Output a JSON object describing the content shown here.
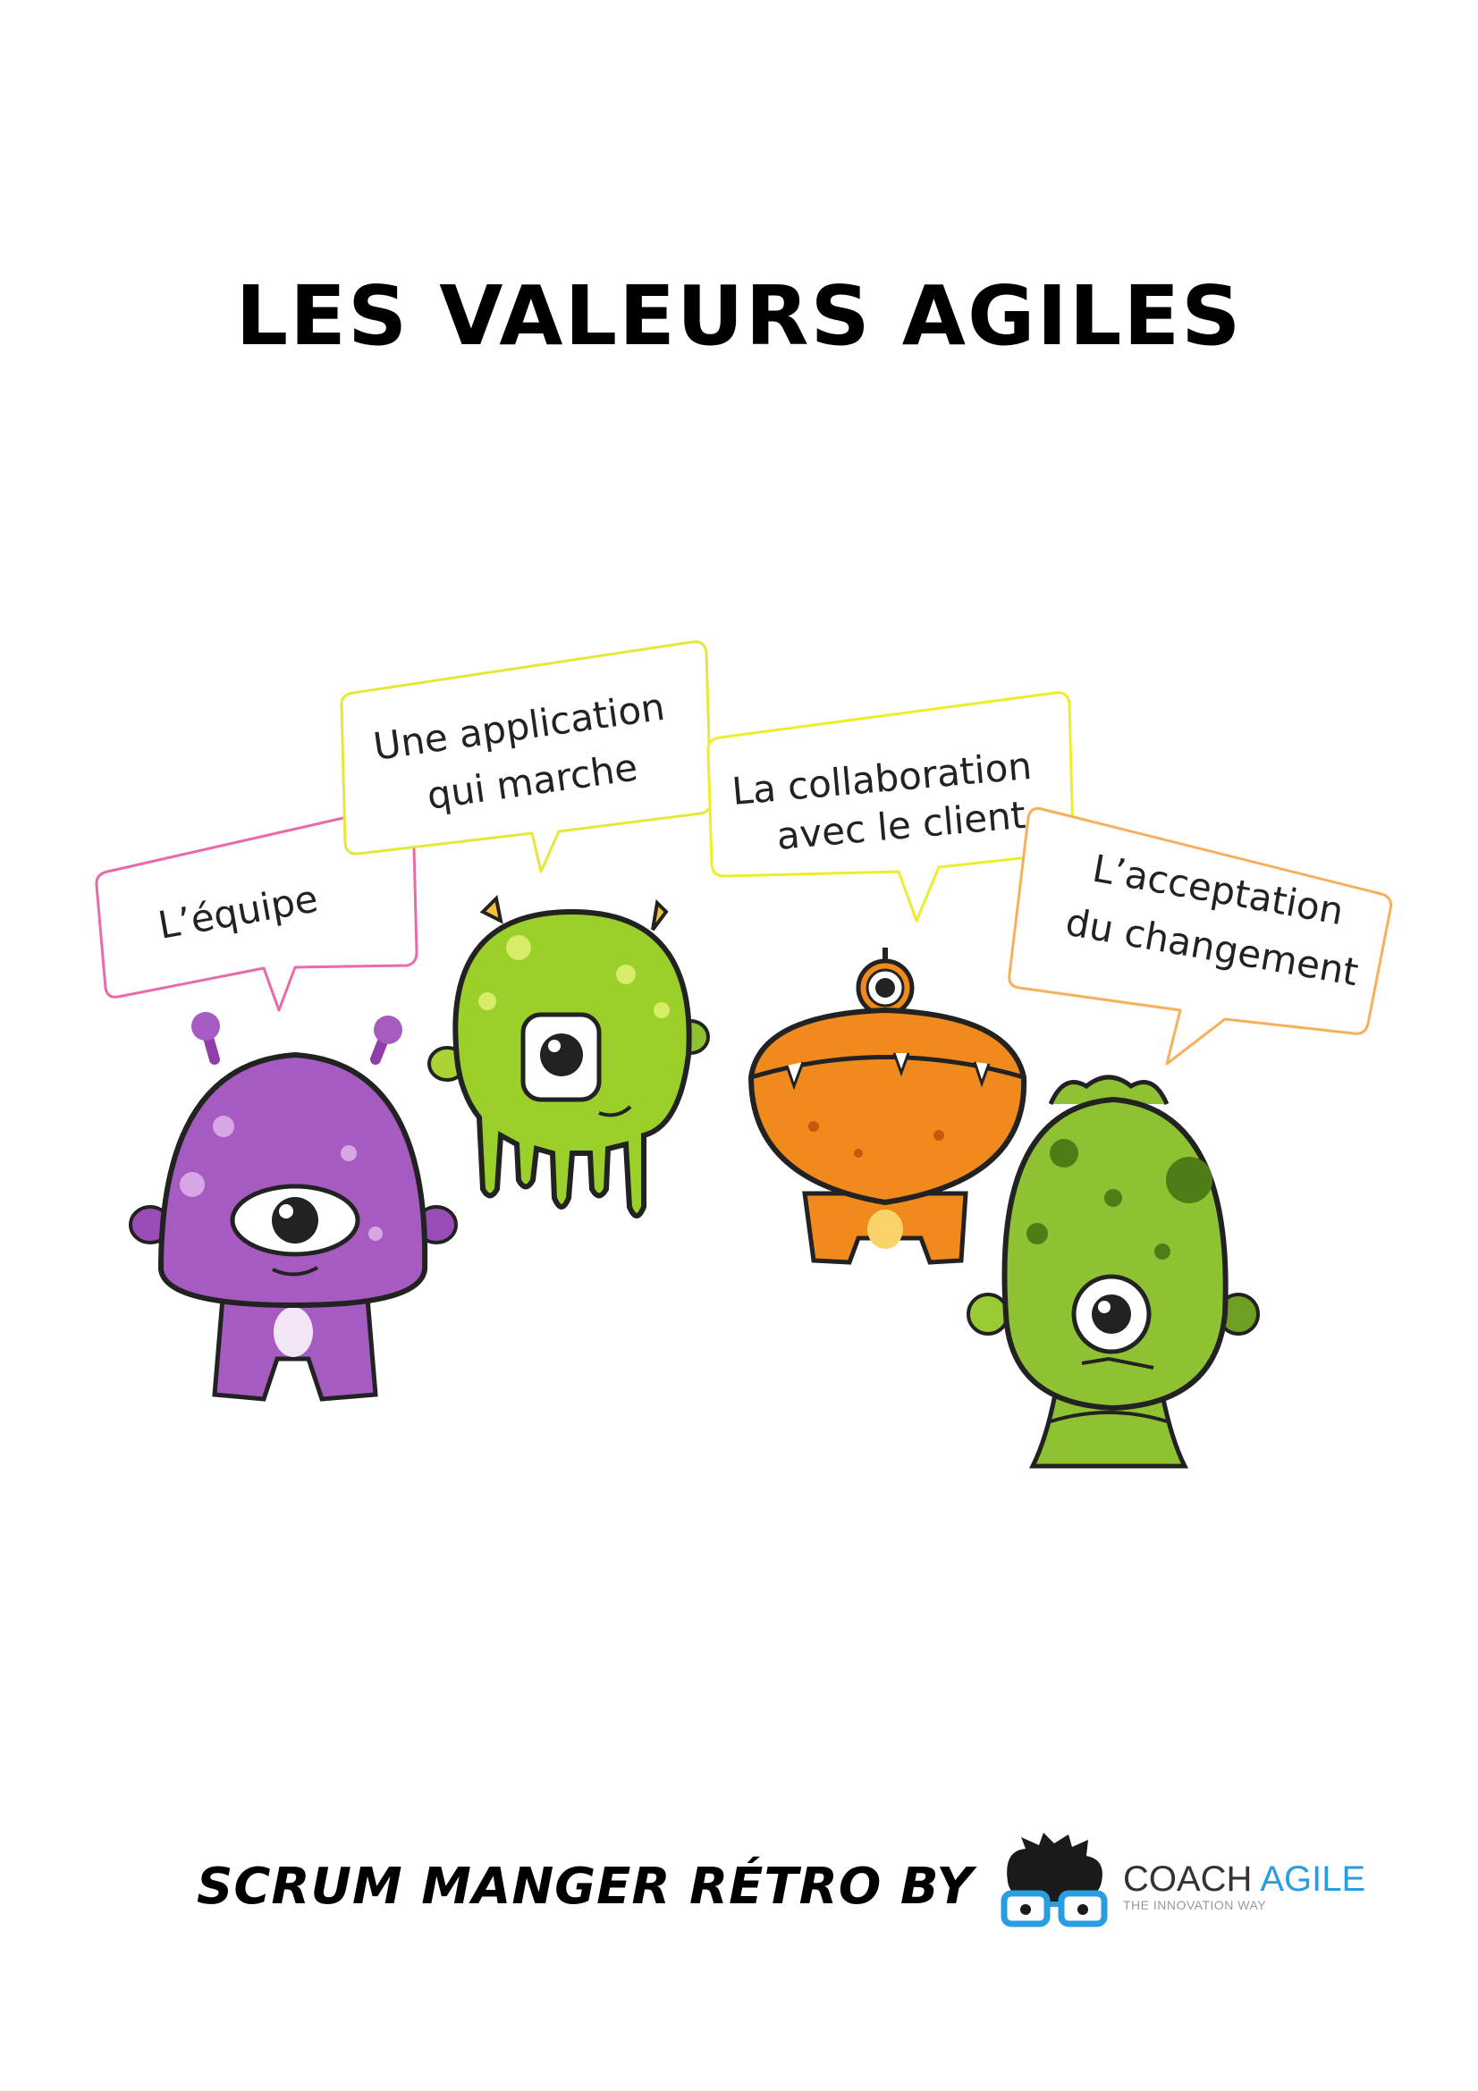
{
  "title": "LES VALEURS AGILES",
  "bubbles": [
    {
      "id": "equipe",
      "color": "#e86aa8",
      "lines": [
        "L’équipe"
      ]
    },
    {
      "id": "application",
      "color": "#e4e83a",
      "lines": [
        "Une application",
        "qui marche"
      ]
    },
    {
      "id": "collaboration",
      "color": "#eded2a",
      "lines": [
        "La collaboration",
        "avec le client"
      ]
    },
    {
      "id": "changement",
      "color": "#f6b05a",
      "lines": [
        "L’acceptation",
        "du changement"
      ]
    }
  ],
  "monsters": [
    {
      "id": "purple",
      "color": "#a55bbf"
    },
    {
      "id": "lime",
      "color": "#9bd02a"
    },
    {
      "id": "orange",
      "color": "#f08a1c"
    },
    {
      "id": "green",
      "color": "#8fc233"
    }
  ],
  "footer": {
    "text": "SCRUM MANGER RÉTRO BY",
    "logo_name_main": "COACH ",
    "logo_name_accent": "AGILE",
    "logo_tagline": "THE INNOVATION WAY"
  }
}
